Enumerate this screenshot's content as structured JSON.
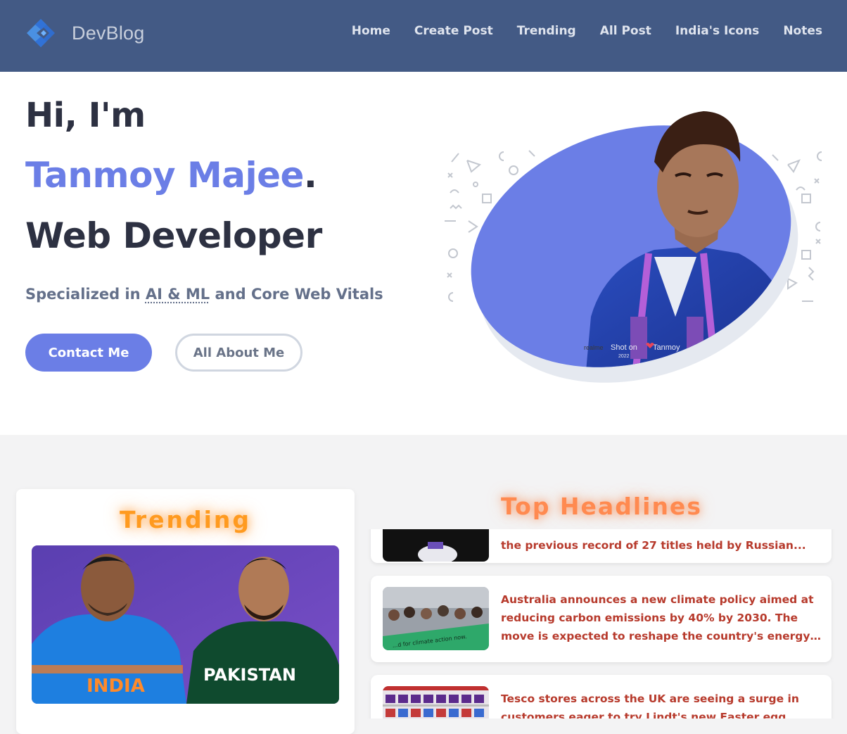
{
  "nav": {
    "logo_text": "DevBlog",
    "links": [
      "Home",
      "Create Post",
      "Trending",
      "All Post",
      "India's Icons",
      "Notes"
    ]
  },
  "hero": {
    "greeting": "Hi, I'm",
    "name": "Tanmoy Majee",
    "name_suffix": ".",
    "role": "Web Developer",
    "specialized_prefix": "Specialized in ",
    "specialized_abbr": "AI & ML",
    "specialized_suffix": " and Core Web Vitals",
    "primary_button": "Contact Me",
    "secondary_button": "All About Me",
    "photo_watermark": {
      "brand": "realme",
      "line1": "Shot on",
      "line2": "Tanmoy",
      "year": "2022"
    }
  },
  "trending": {
    "title": "Trending",
    "jersey_left": "INDIA",
    "jersey_right": "PAKISTAN"
  },
  "headlines": {
    "title": "Top Headlines",
    "items": [
      {
        "text": "the previous record of 27 titles held by Russian..."
      },
      {
        "text": "Australia announces a new climate policy aimed at reducing carbon emissions by 40% by 2030. The move is expected to reshape the country's energy sector an...",
        "banner": "...d for climate action now."
      },
      {
        "text": "Tesco stores across the UK are seeing a surge in customers eager to try Lindt's new Easter egg flavours;"
      }
    ]
  },
  "colors": {
    "nav_bg": "#435a85",
    "accent": "#6b7ee6",
    "dark_text": "#2d3142",
    "trending_glow": "#ff9a1f",
    "headline_text": "#b73a2c"
  }
}
